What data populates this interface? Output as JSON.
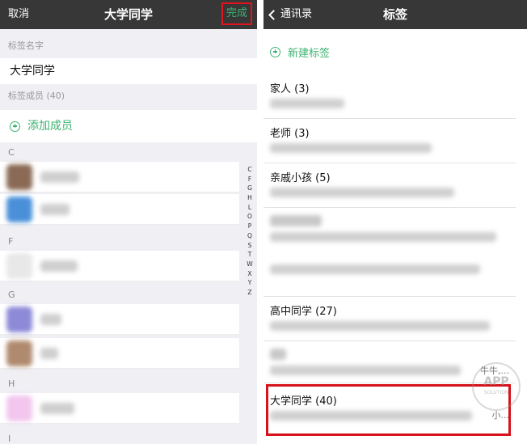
{
  "left_screen": {
    "nav": {
      "cancel_label": "取消",
      "title": "大学同学",
      "done_label": "完成"
    },
    "tag_name_label": "标签名字",
    "tag_name_value": "大学同学",
    "members_label": "标签成员 (40)",
    "add_member_label": "添加成员",
    "groups": [
      {
        "letter": "C"
      },
      {
        "letter": "F"
      },
      {
        "letter": "G"
      },
      {
        "letter": "H"
      },
      {
        "letter": "I"
      }
    ],
    "index_letters": [
      "C",
      "F",
      "G",
      "H",
      "L",
      "O",
      "P",
      "Q",
      "S",
      "T",
      "W",
      "X",
      "Y",
      "Z"
    ]
  },
  "right_screen": {
    "nav": {
      "back_label": "通讯录",
      "title": "标签"
    },
    "new_tag_label": "新建标签",
    "tags": [
      {
        "title": "家人 (3)"
      },
      {
        "title": "老师 (3)"
      },
      {
        "title": "亲戚小孩 (5)"
      },
      {
        "title": ""
      },
      {
        "title": "高中同学 (27)"
      },
      {
        "title": "",
        "members_tail": "牛牛,..."
      },
      {
        "title": "大学同学 (40)",
        "members_tail": "小..."
      }
    ]
  },
  "watermark": {
    "text": "APP",
    "subtext": "SOLUTION"
  },
  "colors": {
    "accent_green": "#3cb371",
    "highlight_red": "#d6121a",
    "navbar": "#373737"
  }
}
